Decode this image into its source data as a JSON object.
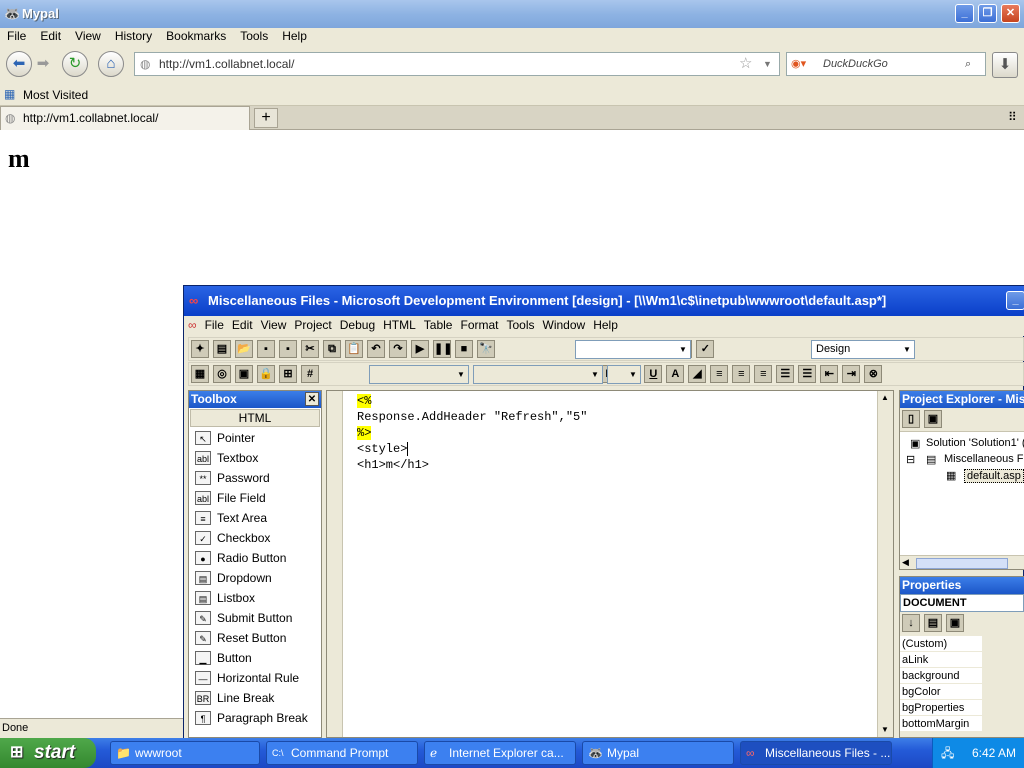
{
  "firefox": {
    "title": "Mypal",
    "menu": [
      "File",
      "Edit",
      "View",
      "History",
      "Bookmarks",
      "Tools",
      "Help"
    ],
    "url": "http://vm1.collabnet.local/",
    "search_placeholder": "DuckDuckGo",
    "bookmarks": {
      "most_visited": "Most Visited"
    },
    "tab": {
      "label": "http://vm1.collabnet.local/",
      "new_tab": "+"
    },
    "content_heading": "m",
    "status": "Done"
  },
  "vs": {
    "title": "Miscellaneous Files - Microsoft Development Environment [design] - [\\\\Wm1\\c$\\inetpub\\wwwroot\\default.asp*]",
    "menu": [
      "File",
      "Edit",
      "View",
      "Project",
      "Debug",
      "HTML",
      "Table",
      "Format",
      "Tools",
      "Window",
      "Help"
    ],
    "view_combo": "Design",
    "toolbox": {
      "header": "Toolbox",
      "group": "HTML",
      "items": [
        {
          "label": "Pointer",
          "icon": "pointer-icon",
          "glyph": "↖"
        },
        {
          "label": "Textbox",
          "icon": "textbox-icon",
          "glyph": "abl"
        },
        {
          "label": "Password",
          "icon": "password-icon",
          "glyph": "**"
        },
        {
          "label": "File Field",
          "icon": "file-field-icon",
          "glyph": "abl"
        },
        {
          "label": "Text Area",
          "icon": "text-area-icon",
          "glyph": "≡"
        },
        {
          "label": "Checkbox",
          "icon": "checkbox-icon",
          "glyph": "✓"
        },
        {
          "label": "Radio Button",
          "icon": "radio-button-icon",
          "glyph": "●"
        },
        {
          "label": "Dropdown",
          "icon": "dropdown-icon",
          "glyph": "▤"
        },
        {
          "label": "Listbox",
          "icon": "listbox-icon",
          "glyph": "▤"
        },
        {
          "label": "Submit Button",
          "icon": "submit-button-icon",
          "glyph": "✎"
        },
        {
          "label": "Reset Button",
          "icon": "reset-button-icon",
          "glyph": "✎"
        },
        {
          "label": "Button",
          "icon": "button-icon",
          "glyph": "▁"
        },
        {
          "label": "Horizontal Rule",
          "icon": "horizontal-rule-icon",
          "glyph": "—"
        },
        {
          "label": "Line Break",
          "icon": "line-break-icon",
          "glyph": "BR"
        },
        {
          "label": "Paragraph Break",
          "icon": "paragraph-break-icon",
          "glyph": "¶"
        }
      ]
    },
    "code": [
      "<%",
      "Response.AddHeader \"Refresh\",\"5\"",
      "%>",
      "<style>",
      "<h1>m</h1>"
    ],
    "project_explorer": {
      "header": "Project Explorer - Misc",
      "solution": "Solution 'Solution1' (",
      "folder": "Miscellaneous Fil",
      "file": "default.asp"
    },
    "properties": {
      "header": "Properties",
      "object": "DOCUMENT",
      "rows": [
        "(Custom)",
        "aLink",
        "background",
        "bgColor",
        "bgProperties",
        "bottomMargin"
      ]
    }
  },
  "taskbar": {
    "start": "start",
    "tasks": [
      "wwwroot",
      "Command Prompt",
      "Internet Explorer ca...",
      "Mypal",
      "Miscellaneous Files - ..."
    ],
    "clock": "6:42 AM"
  },
  "colors": {
    "xp_blue": "#245bd8",
    "highlight_yellow": "#ffff00",
    "face": "#ece9d8"
  }
}
